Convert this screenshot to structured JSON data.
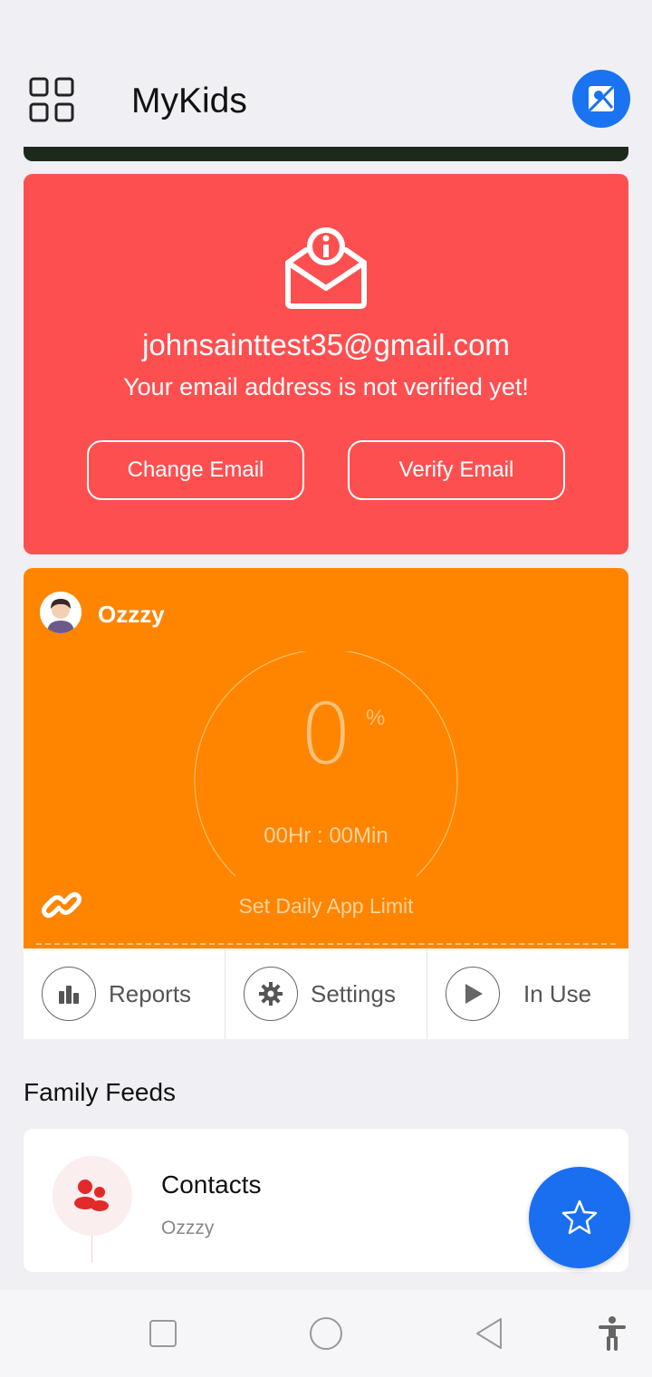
{
  "header": {
    "title": "MyKids",
    "menu_icon": "grid-icon",
    "profile_icon": "image-icon"
  },
  "email_card": {
    "icon": "mail-info-icon",
    "email": "johnsainttest35@gmail.com",
    "message": "Your email address is not verified yet!",
    "change_label": "Change Email",
    "verify_label": "Verify Email",
    "color": "#fe4f50"
  },
  "kid_card": {
    "name": "Ozzzy",
    "percent_value": "0",
    "percent_sign": "%",
    "time": "00Hr : 00Min",
    "limit_label": "Set Daily App Limit",
    "color": "#ff8500"
  },
  "actions": [
    {
      "label": "Reports",
      "icon": "bar-chart-icon"
    },
    {
      "label": "Settings",
      "icon": "gear-icon"
    },
    {
      "label": "In Use",
      "icon": "play-icon"
    }
  ],
  "feeds": {
    "title": "Family Feeds",
    "items": [
      {
        "title": "Contacts",
        "subtitle": "Ozzzy",
        "icon": "contacts-icon"
      }
    ]
  },
  "fab": {
    "icon": "star-icon",
    "color": "#1a6ff0"
  },
  "system_nav": {
    "recent_icon": "square-icon",
    "home_icon": "circle-icon",
    "back_icon": "triangle-back-icon",
    "accessibility_icon": "accessibility-icon"
  }
}
